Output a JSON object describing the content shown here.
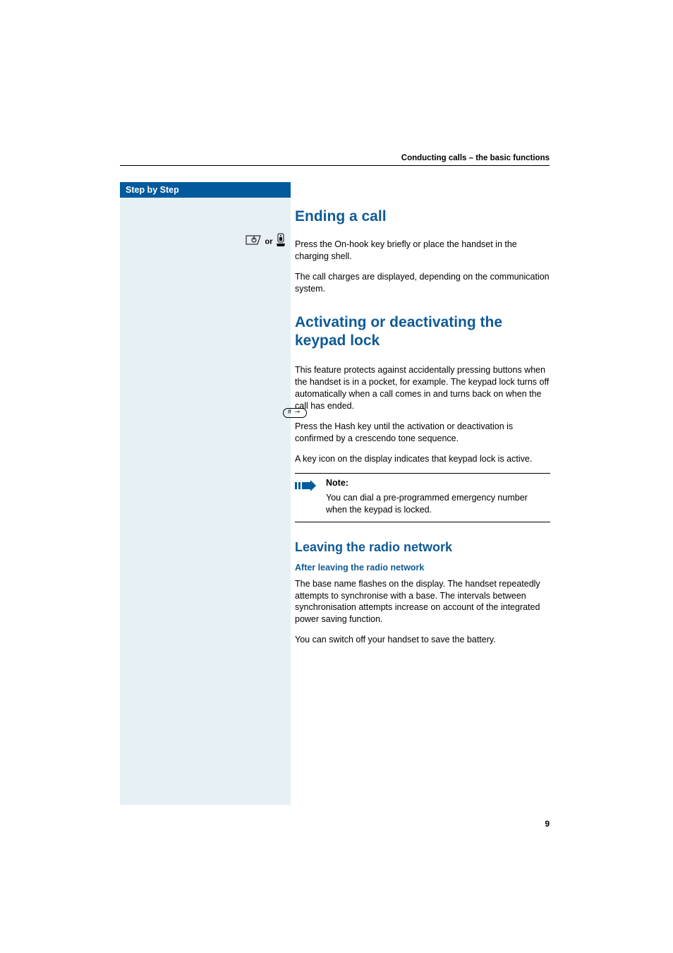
{
  "running_header": "Conducting calls – the basic functions",
  "sidebar_title": "Step by Step",
  "aside_or": "or",
  "sections": {
    "ending": {
      "title": "Ending a call",
      "p1": "Press the On-hook key briefly or place the handset in the charging shell.",
      "p2": "The call charges are displayed, depending on the communication system."
    },
    "keypad": {
      "title": "Activating or deactivating the keypad lock",
      "p1": "This feature protects against accidentally pressing buttons when the handset is in a pocket, for example. The keypad lock turns off automatically when a call comes in and turns back on when the call has ended.",
      "p2": "Press the Hash key until the activation or deactivation is confirmed by a crescendo tone sequence.",
      "p3": "A key icon on the display indicates that keypad lock is active.",
      "note_label": "Note:",
      "note_text": "You can dial a pre-programmed emergency number when the keypad is locked."
    },
    "radio": {
      "title": "Leaving the radio network",
      "sub": "After leaving the radio network",
      "p1": "The base name flashes on the display. The handset repeatedly attempts to synchronise with a base. The intervals between synchronisation attempts increase on account of the integrated power saving function.",
      "p2": "You can switch off your handset to save the battery."
    }
  },
  "page_number": "9"
}
